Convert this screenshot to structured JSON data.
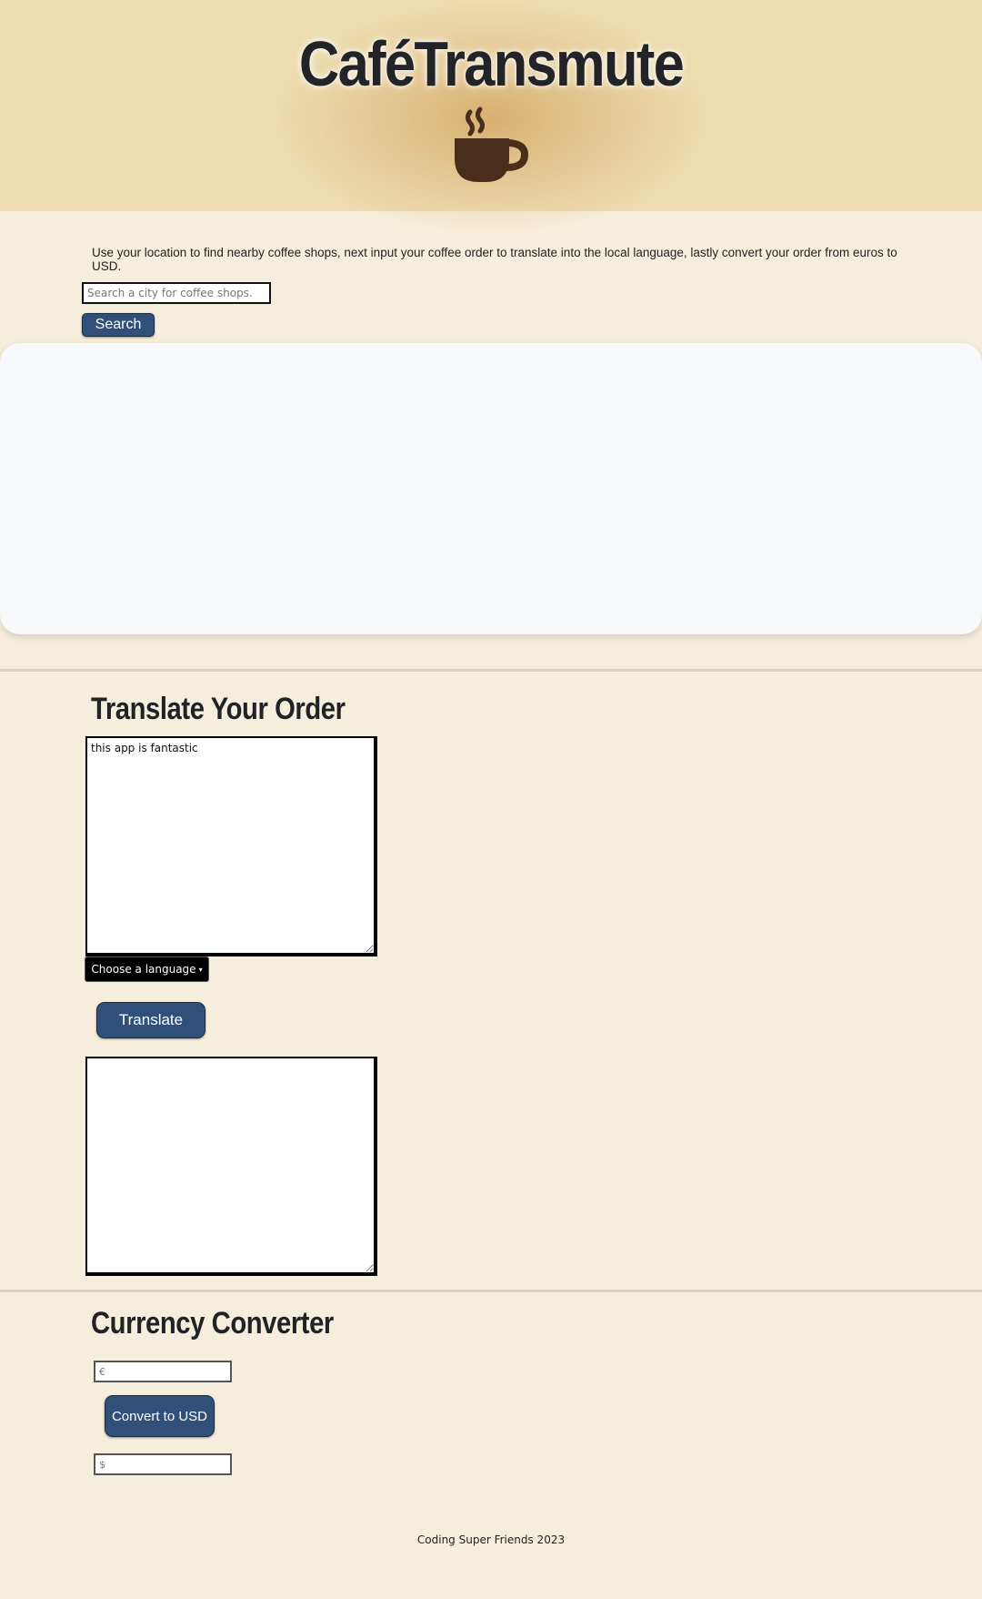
{
  "header": {
    "title": "CaféTransmute",
    "logo_icon": "coffee-cup-icon"
  },
  "intro": "Use your location to find nearby coffee shops, next input your coffee order to translate into the local language, lastly convert your order from euros to USD.",
  "search": {
    "placeholder": "Search a city for coffee shops.",
    "button_label": "Search"
  },
  "translate": {
    "title": "Translate Your Order",
    "input_value": "this app is fantastic",
    "language_button": "Choose a language",
    "button_label": "Translate",
    "output_value": ""
  },
  "currency": {
    "title": "Currency Converter",
    "euro_placeholder": "€",
    "button_label": "Convert to USD",
    "usd_placeholder": "$"
  },
  "footer": "Coding Super Friends 2023",
  "colors": {
    "background": "#f6eedc",
    "header": "#ecdcb0",
    "button": "#30507a",
    "cup": "#4a2e1c"
  }
}
